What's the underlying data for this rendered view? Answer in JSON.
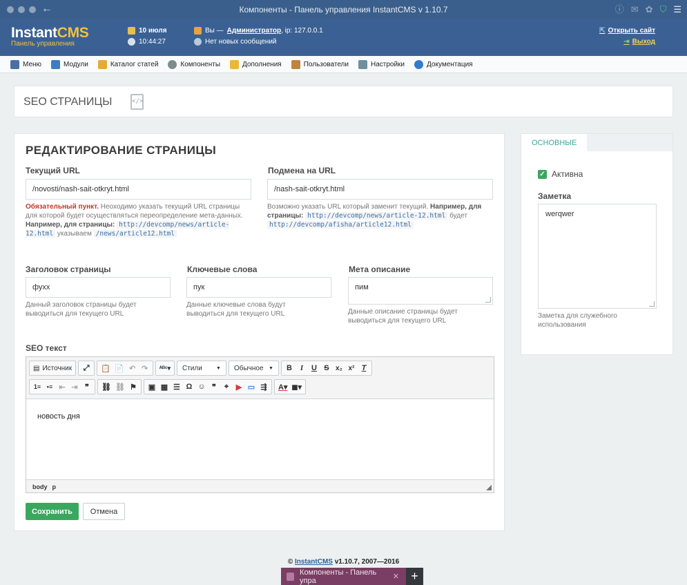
{
  "window": {
    "title": "Компоненты - Панель управления InstantCMS v 1.10.7"
  },
  "header": {
    "logo_main": "Instant",
    "logo_accent": "CMS",
    "logo_sub": "Панель управления",
    "date": "10 июля",
    "time": "10:44:27",
    "user_prefix": "Вы —",
    "user_name": "Администратор",
    "ip": ", ip: 127.0.0.1",
    "messages": "Нет новых сообщений",
    "open_site": "Открыть сайт",
    "logout": "Выход"
  },
  "menu": [
    {
      "label": "Меню",
      "color": "#4a6fa5"
    },
    {
      "label": "Модули",
      "color": "#3f7cc2"
    },
    {
      "label": "Каталог статей",
      "color": "#e6a93a"
    },
    {
      "label": "Компоненты",
      "color": "#7f8c8d"
    },
    {
      "label": "Дополнения",
      "color": "#e8b83c"
    },
    {
      "label": "Пользователи",
      "color": "#c0843d"
    },
    {
      "label": "Настройки",
      "color": "#6f8f9f"
    },
    {
      "label": "Документация",
      "color": "#2f7bd0"
    }
  ],
  "page": {
    "title": "SEO СТРАНИЦЫ"
  },
  "form": {
    "title": "РЕДАКТИРОВАНИЕ СТРАНИЦЫ",
    "current_url": {
      "label": "Текущий URL",
      "value": "/novosti/nash-sait-otkryt.html",
      "hint_required": "Обязательный пункт.",
      "hint_text": " Неоходимо указать текущий URL страницы для которой будет осуществляться переопределение мета-данных. ",
      "hint_example": "Например, для страницы:",
      "hint_code1": "http://devcomp/news/article-12.html",
      "hint_mid": " указываем ",
      "hint_code2": "/news/article12.html"
    },
    "replace_url": {
      "label": "Подмена на URL",
      "value": "/nash-sait-otkryt.html",
      "hint_text": "Возможно указать URL который заменит текущий. ",
      "hint_example": "Например, для страницы:",
      "hint_code1": "http://devcomp/news/article-12.html",
      "hint_mid": " будет ",
      "hint_code2": "http://devcomp/afisha/article12.html"
    },
    "page_title": {
      "label": "Заголовок страницы",
      "value": "фухх",
      "hint": "Данный заголовок страницы будет выводиться для текущего URL"
    },
    "keywords": {
      "label": "Ключевые слова",
      "value": "пук",
      "hint": "Данные ключевые слова будут выводиться для текущего URL"
    },
    "meta_description": {
      "label": "Мета описание",
      "value": "пим",
      "hint": "Данные описание страницы будет выводиться для текущего URL"
    },
    "seo_text": {
      "label": "SEO текст",
      "content": "новость дня",
      "source_label": "Источник",
      "styles_label": "Стили",
      "format_label": "Обычное",
      "status_path": [
        "body",
        "p"
      ]
    },
    "save_label": "Сохранить",
    "cancel_label": "Отмена"
  },
  "side": {
    "tab_label": "ОСНОВНЫЕ",
    "active_label": "Активна",
    "note_label": "Заметка",
    "note_value": "werqwer",
    "note_hint": "Заметка для служебного использования"
  },
  "footer": {
    "copyright": "©",
    "brand": "InstantCMS",
    "version": " v1.10.7, 2007—2016"
  },
  "dock": {
    "tab_label": "Компоненты - Панель упра"
  }
}
